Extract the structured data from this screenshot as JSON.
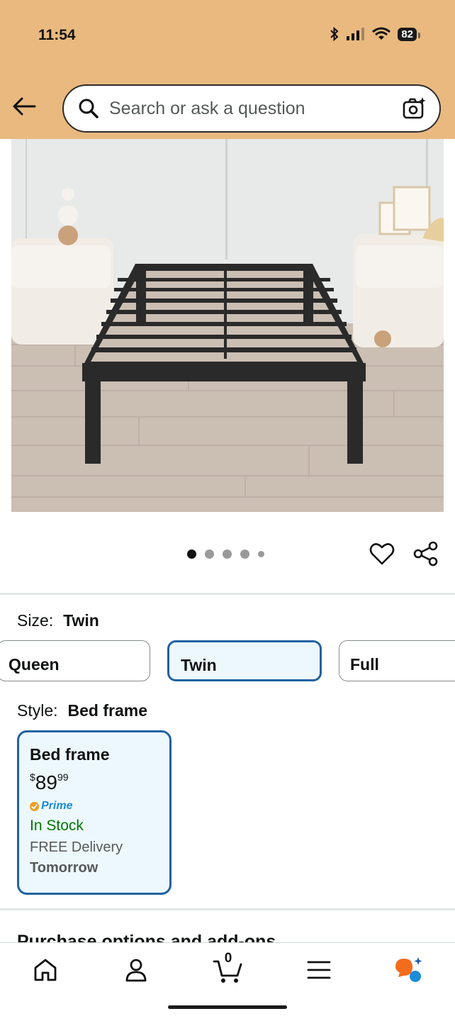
{
  "status_bar": {
    "time": "11:54",
    "battery": "82"
  },
  "header": {
    "search_placeholder": "Search or ask a question"
  },
  "carousel": {
    "dot_count": 5,
    "active_index": 0
  },
  "size": {
    "label": "Size:",
    "selected": "Twin",
    "options": [
      "Queen",
      "Twin",
      "Full"
    ]
  },
  "style": {
    "label": "Style:",
    "selected": "Bed frame",
    "card": {
      "name": "Bed frame",
      "currency": "$",
      "price_whole": "89",
      "price_fraction": "99",
      "prime": "Prime",
      "stock": "In Stock",
      "delivery": "FREE Delivery",
      "delivery_day": "Tomorrow"
    }
  },
  "next_section": {
    "heading": "Purchase options and add-ons"
  },
  "bottom_nav": {
    "cart_count": "0"
  },
  "colors": {
    "header_bg": "#eab97f",
    "selected_border": "#2162a1",
    "selected_bg": "#edf8fd",
    "in_stock": "#007600",
    "prime": "#1a8cd8"
  }
}
